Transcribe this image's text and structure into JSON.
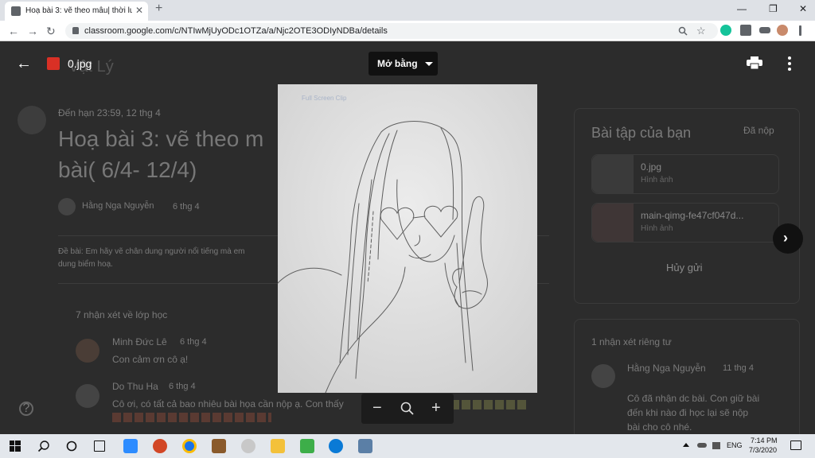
{
  "browser": {
    "tab_title": "Hoạ bài 3: vẽ theo mẫu| thời lượ",
    "tab_close": "✕",
    "new_tab": "+",
    "url": "classroom.google.com/c/NTIwMjUyODc1OTZa/a/Njc2OTE3ODIyNDBa/details",
    "back": "←",
    "forward": "→",
    "reload": "↻",
    "minimize": "—",
    "maximize": "❐",
    "close": "✕",
    "zoom_icon": "search-icon",
    "star": "☆"
  },
  "background": {
    "class_title": "Vật Lý",
    "due": "Đến hạn 23:59, 12 thg 4",
    "assignment_title": "Hoạ bài 3: vẽ theo m… bài( 6/4- 12/4)",
    "assignment_title_line1": "Hoạ bài 3: vẽ theo m",
    "assignment_title_line2": "bài( 6/4- 12/4)",
    "author": "Hằng Nga Nguyễn",
    "date": "6 thg 4",
    "description": "Đề bài: Em hãy vẽ chân dung người nổi tiếng mà em",
    "description_2": "dung biểm hoạ.",
    "class_comments": "7 nhận xét về lớp học",
    "comments": [
      {
        "name": "Minh Đức Lê",
        "date": "6 thg 4",
        "text": "Con cảm ơn cô ạ!"
      },
      {
        "name": "Do Thu Ha",
        "date": "6 thg 4",
        "text": "Cô ơi, có tất cả bao nhiêu bài họa cần nộp ạ. Con thấy"
      }
    ],
    "your_work": "Bài tập của bạn",
    "submitted": "Đã nộp",
    "attachments": [
      {
        "name": "0.jpg",
        "type": "Hình ảnh"
      },
      {
        "name": "main-qimg-fe47cf047d...",
        "type": "Hình ảnh"
      }
    ],
    "unsubmit": "Hủy gửi",
    "private_comments": "1 nhận xét riêng tư",
    "private_comment": {
      "name": "Hằng Nga Nguyễn",
      "date": "11 thg 4",
      "text_1": "Cô đã nhận dc bài. Con giữ bài",
      "text_2": "đến khi nào đi học lại sẽ nộp",
      "text_3": "bài cho cô nhé."
    }
  },
  "viewer": {
    "back_icon": "←",
    "file_name": "0.jpg",
    "open_with": "Mở bằng",
    "zoom_out": "−",
    "zoom_in": "+",
    "next": "›",
    "image_watermark": "Full Screen Clip"
  },
  "taskbar": {
    "time": "7:14 PM",
    "date": "7/3/2020",
    "language": "ENG"
  },
  "colors": {
    "accent_red": "#d93025",
    "viewer_bg": "#2c2c2c",
    "taskbar": "#e3e7ec"
  }
}
